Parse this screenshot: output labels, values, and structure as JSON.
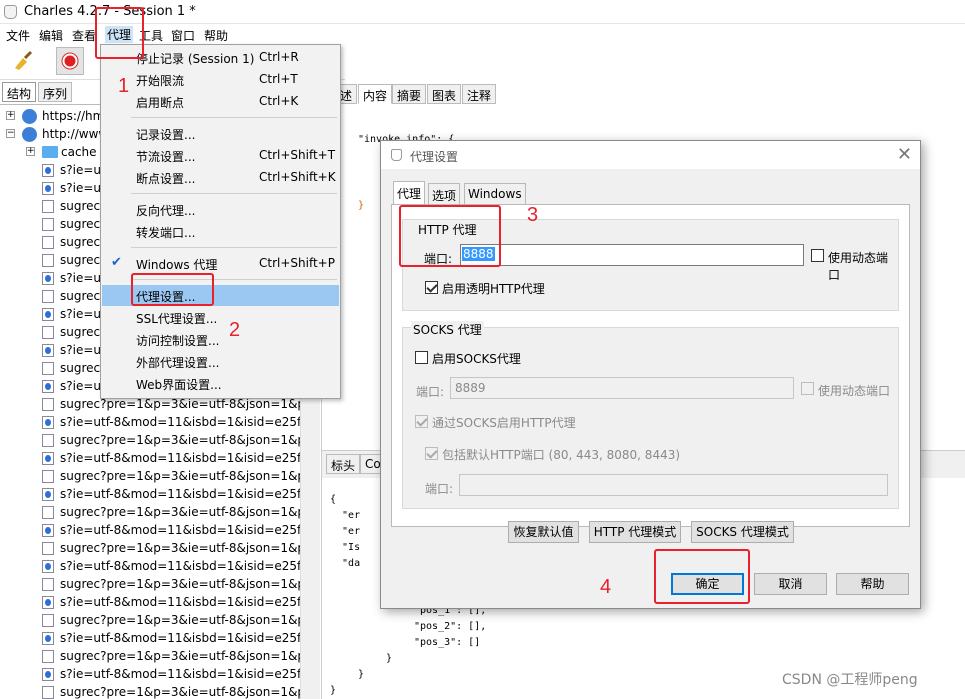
{
  "window": {
    "title": "Charles 4.2.7 - Session 1 *"
  },
  "menubar": [
    "文件",
    "编辑",
    "查看",
    "代理",
    "工具",
    "窗口",
    "帮助"
  ],
  "left_tabs": [
    "结构",
    "序列"
  ],
  "tree": {
    "hosts": [
      "https://hm",
      "http://www"
    ],
    "folder": "cache",
    "items": [
      "s?ie=ut",
      "s?ie=ut",
      "sugrec",
      "sugrec",
      "sugrec",
      "sugrec",
      "s?ie=ut",
      "sugrec",
      "s?ie=ut",
      "sugrec",
      "s?ie=ut",
      "sugrec",
      "s?ie=ut",
      "sugrec?pre=1&p=3&ie=utf-8&json=1&p",
      "s?ie=utf-8&mod=11&isbd=1&isid=e25f",
      "sugrec?pre=1&p=3&ie=utf-8&json=1&p",
      "s?ie=utf-8&mod=11&isbd=1&isid=e25f",
      "sugrec?pre=1&p=3&ie=utf-8&json=1&p",
      "s?ie=utf-8&mod=11&isbd=1&isid=e25f",
      "sugrec?pre=1&p=3&ie=utf-8&json=1&p",
      "s?ie=utf-8&mod=11&isbd=1&isid=e25f",
      "sugrec?pre=1&p=3&ie=utf-8&json=1&p",
      "s?ie=utf-8&mod=11&isbd=1&isid=e25f",
      "sugrec?pre=1&p=3&ie=utf-8&json=1&p",
      "s?ie=utf-8&mod=11&isbd=1&isid=e25f",
      "sugrec?pre=1&p=3&ie=utf-8&json=1&p",
      "s?ie=utf-8&mod=11&isbd=1&isid=e25f",
      "sugrec?pre=1&p=3&ie=utf-8&json=1&p",
      "s?ie=utf-8&mod=11&isbd=1&isid=e25f",
      "sugrec?pre=1&p=3&ie=utf-8&json=1&p"
    ]
  },
  "right_tabs": [
    "述",
    "内容",
    "摘要",
    "图表",
    "注释"
  ],
  "right_bottom_tabs": [
    "标头",
    "Co"
  ],
  "code_top": [
    "\"invoke_info\": {",
    "}"
  ],
  "code_bottom": [
    "{",
    "  \"er",
    "  \"er",
    "  \"Is",
    "  \"da"
  ],
  "code_tail": [
    "\"pos_1\": [],",
    "\"pos_2\": [],",
    "\"pos_3\": []",
    "}",
    "}",
    "}"
  ],
  "menu": {
    "items": [
      {
        "label": "停止记录 (Session 1)",
        "key": "Ctrl+R"
      },
      {
        "label": "开始限流",
        "key": "Ctrl+T"
      },
      {
        "label": "启用断点",
        "key": "Ctrl+K"
      },
      {
        "label": "记录设置...",
        "key": ""
      },
      {
        "label": "节流设置...",
        "key": "Ctrl+Shift+T"
      },
      {
        "label": "断点设置...",
        "key": "Ctrl+Shift+K"
      },
      {
        "label": "反向代理...",
        "key": ""
      },
      {
        "label": "转发端口...",
        "key": ""
      },
      {
        "label": "Windows 代理",
        "key": "Ctrl+Shift+P"
      },
      {
        "label": "代理设置...",
        "key": ""
      },
      {
        "label": "SSL代理设置...",
        "key": ""
      },
      {
        "label": "访问控制设置...",
        "key": ""
      },
      {
        "label": "外部代理设置...",
        "key": ""
      },
      {
        "label": "Web界面设置...",
        "key": ""
      }
    ]
  },
  "dialog": {
    "title": "代理设置",
    "tabs": [
      "代理",
      "选项",
      "Windows"
    ],
    "http": {
      "title": "HTTP 代理",
      "port_label": "端口:",
      "port": "8888",
      "dynamic": "使用动态端口",
      "transparent": "启用透明HTTP代理"
    },
    "socks": {
      "title": "SOCKS 代理",
      "enable": "启用SOCKS代理",
      "port_label": "端口:",
      "port": "8889",
      "dynamic": "使用动态端口",
      "via": "通过SOCKS启用HTTP代理",
      "include": "包括默认HTTP端口 (80, 443, 8080, 8443)",
      "port2_label": "端口:"
    },
    "buttons": {
      "restore": "恢复默认值",
      "http_mode": "HTTP 代理模式",
      "socks_mode": "SOCKS 代理模式",
      "ok": "确定",
      "cancel": "取消",
      "help": "帮助"
    }
  },
  "annotations": [
    "1",
    "2",
    "3",
    "4"
  ],
  "watermark": "CSDN @工程师peng"
}
